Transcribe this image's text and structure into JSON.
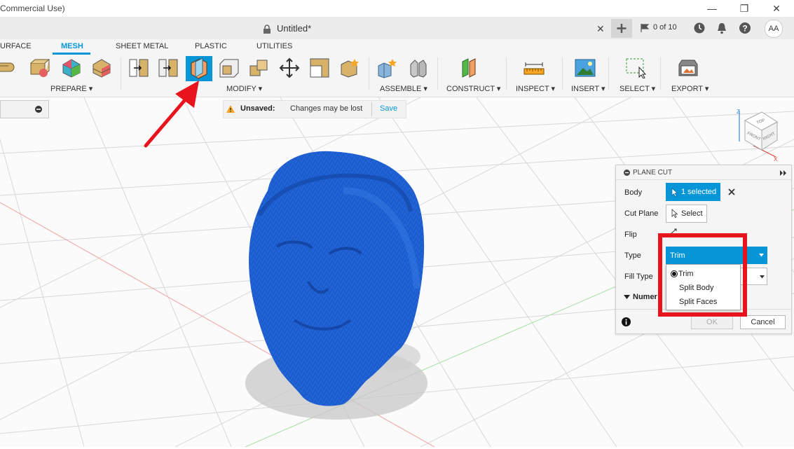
{
  "window": {
    "title_fragment": "Commercial Use)",
    "minimize": "—",
    "restore": "❐",
    "close": "✕"
  },
  "doc": {
    "title": "Untitled*",
    "close": "✕",
    "job_count": "0 of 10",
    "avatar": "AA"
  },
  "tabs": [
    "URFACE",
    "MESH",
    "SHEET METAL",
    "PLASTIC",
    "UTILITIES"
  ],
  "groups": {
    "prepare": "PREPARE ▾",
    "modify": "MODIFY ▾",
    "assemble": "ASSEMBLE ▾",
    "construct": "CONSTRUCT ▾",
    "inspect": "INSPECT ▾",
    "insert": "INSERT ▾",
    "select": "SELECT ▾",
    "export": "EXPORT ▾"
  },
  "unsaved": {
    "label": "Unsaved:",
    "message": "Changes may be lost",
    "save": "Save"
  },
  "viewcube": {
    "top": "TOP",
    "front": "FRONT",
    "right": "RIGHT",
    "z": "Z",
    "x": "X"
  },
  "panel": {
    "title": "PLANE CUT",
    "body_label": "Body",
    "body_value": "1 selected",
    "cut_plane_label": "Cut Plane",
    "cut_plane_value": "Select",
    "flip_label": "Flip",
    "type_label": "Type",
    "type_value": "Trim",
    "fill_type_label": "Fill Type",
    "numeric_label": "Numer",
    "ok": "OK",
    "cancel": "Cancel",
    "type_options": [
      "Trim",
      "Split Body",
      "Split Faces"
    ]
  },
  "colors": {
    "accent": "#0696d7",
    "highlight": "#e8141d",
    "mesh": "#1f63d6"
  }
}
